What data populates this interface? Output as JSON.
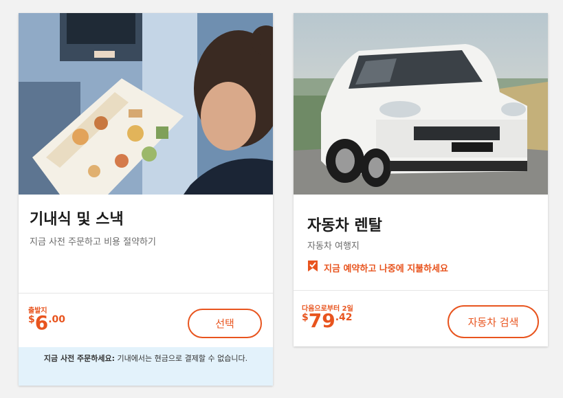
{
  "colors": {
    "accent": "#e8541e",
    "info_background": "#e3f2fb",
    "page_background": "#f2f2f2"
  },
  "cards": [
    {
      "id": "meals",
      "title": "기내식 및 스낵",
      "subtitle": "지금 사전 주문하고 비용 절약하기",
      "price_label": "출발지",
      "price_currency": "$",
      "price_main": "6",
      "price_cents": ".00",
      "button_label": "선택",
      "info_bold": "지금 사전 주문하세요:",
      "info_text": " 기내에서는 현금으로 결제할 수 없습니다.",
      "image_icon": "woman-reading-menu-photo"
    },
    {
      "id": "car",
      "title": "자동차 렌탈",
      "subtitle": "자동차 여행지",
      "notice": "지금 예약하고 나중에 지불하세요",
      "notice_icon": "bookmark-check-icon",
      "price_label": "다음으로부터 2일",
      "price_currency": "$",
      "price_main": "79",
      "price_cents": ".42",
      "button_label": "자동차 검색",
      "image_icon": "white-suv-photo"
    }
  ]
}
